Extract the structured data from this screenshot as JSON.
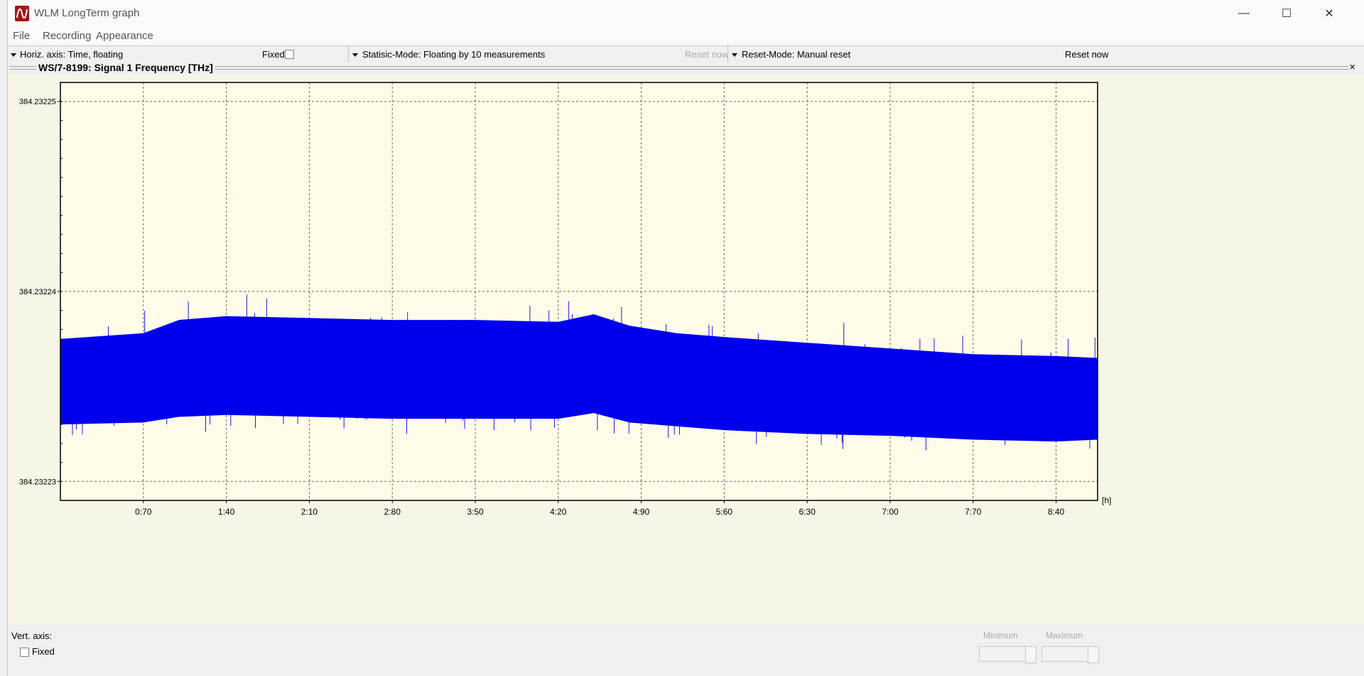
{
  "window": {
    "title": "WLM LongTerm graph",
    "controls": {
      "minimize": "—",
      "maximize": "☐",
      "close": "✕"
    }
  },
  "menu": [
    "File",
    "Recording",
    "Appearance"
  ],
  "toolbar": {
    "horiz_axis_label": "Horiz. axis: Time,  floating",
    "fixed_label": "Fixed",
    "statistic_mode": "Statisic-Mode: Floating by 10 measurements",
    "reset_now_disabled": "Reset now",
    "reset_mode": "Reset-Mode: Manual reset",
    "reset_now": "Reset now"
  },
  "graph": {
    "title": "WS/7-8199: Signal 1  Frequency  [THz]",
    "close_glyph": "✕"
  },
  "chart_data": {
    "type": "line",
    "title": "WS/7-8199: Signal 1  Frequency  [THz]",
    "xlabel": "[h]",
    "ylabel": "",
    "x_ticks": [
      "0:70",
      "1:40",
      "2:10",
      "2:80",
      "3:50",
      "4:20",
      "4:90",
      "5:60",
      "6:30",
      "7:00",
      "7:70",
      "8:40"
    ],
    "y_ticks": [
      "384.23225",
      "384.23224",
      "384.23223"
    ],
    "ylim": [
      384.232229,
      384.232251
    ],
    "grid": true,
    "series": [
      {
        "color": "#0000ee",
        "band_x": [
          0,
          0.7,
          1.0,
          1.4,
          2.1,
          2.8,
          3.5,
          4.2,
          4.5,
          4.8,
          5.2,
          5.6,
          6.3,
          7.0,
          7.7,
          8.4,
          8.75
        ],
        "upper": [
          384.2322375,
          384.2322378,
          384.2322385,
          384.2322387,
          384.2322386,
          384.2322385,
          384.2322385,
          384.2322384,
          384.2322388,
          384.2322382,
          384.2322378,
          384.2322376,
          384.2322373,
          384.232237,
          384.2322367,
          384.2322366,
          384.2322365
        ],
        "lower": [
          384.232233,
          384.2322331,
          384.2322334,
          384.2322335,
          384.2322334,
          384.2322333,
          384.2322333,
          384.2322333,
          384.2322336,
          384.2322331,
          384.2322329,
          384.2322327,
          384.2322325,
          384.2322324,
          384.2322322,
          384.2322321,
          384.2322322
        ],
        "spike_max": [
          384.2322397,
          384.2322399,
          384.23224,
          384.2322397,
          384.2322398,
          384.23224,
          384.23224,
          384.2322396,
          384.2322395,
          384.232239,
          384.2322383,
          384.232238,
          384.2322378,
          384.2322376,
          384.2322377
        ],
        "spike_min": [
          384.2322318,
          384.2322321,
          384.2322324,
          384.2322325,
          384.2322322,
          384.2322323,
          384.2322319,
          384.2322315,
          384.2322313,
          384.2322312,
          384.2322311,
          384.232231,
          384.2322309,
          384.2322308,
          384.2322309
        ]
      }
    ]
  },
  "bottom": {
    "vert_axis_label": "Vert. axis:",
    "fixed_label": "Fixed",
    "minimum_label": "Minimum",
    "maximum_label": "Maximum",
    "minimum_value": "",
    "maximum_value": ""
  }
}
